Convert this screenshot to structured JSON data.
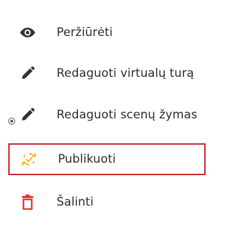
{
  "menu": {
    "items": [
      {
        "label": "Peržiūrėti",
        "icon": "eye-icon"
      },
      {
        "label": "Redaguoti virtualų turą",
        "icon": "pencil-icon"
      },
      {
        "label": "Redaguoti scenų žymas",
        "icon": "pencil-icon"
      },
      {
        "label": "Publikuoti",
        "icon": "sync-icon"
      },
      {
        "label": "Šalinti",
        "icon": "trash-icon"
      }
    ]
  },
  "colors": {
    "text": "#2b2b2b",
    "icon": "#333333",
    "highlight_border": "#c9232d",
    "publish_icon": "#f2b705",
    "delete_icon": "#e53935"
  }
}
